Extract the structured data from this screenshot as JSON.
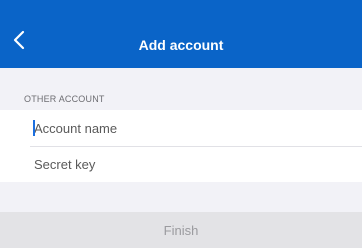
{
  "nav": {
    "title": "Add account",
    "back_icon": "chevron-left-icon",
    "bar_color": "#0a64c8"
  },
  "section": {
    "header": "OTHER ACCOUNT"
  },
  "fields": {
    "account_name": {
      "placeholder": "Account name",
      "value": ""
    },
    "secret_key": {
      "placeholder": "Secret key",
      "value": ""
    }
  },
  "footer": {
    "finish_label": "Finish"
  }
}
